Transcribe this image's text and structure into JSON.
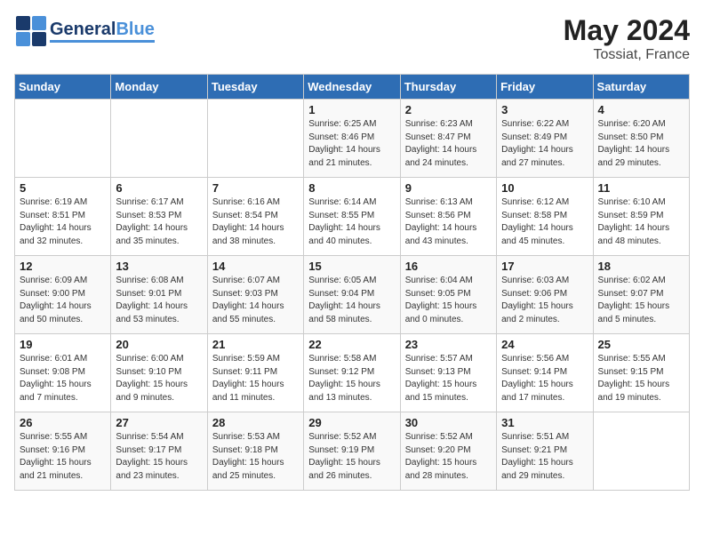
{
  "header": {
    "logo_general": "General",
    "logo_blue": "Blue",
    "month_year": "May 2024",
    "location": "Tossiat, France"
  },
  "days_of_week": [
    "Sunday",
    "Monday",
    "Tuesday",
    "Wednesday",
    "Thursday",
    "Friday",
    "Saturday"
  ],
  "weeks": [
    [
      {
        "day": "",
        "info": ""
      },
      {
        "day": "",
        "info": ""
      },
      {
        "day": "",
        "info": ""
      },
      {
        "day": "1",
        "info": "Sunrise: 6:25 AM\nSunset: 8:46 PM\nDaylight: 14 hours\nand 21 minutes."
      },
      {
        "day": "2",
        "info": "Sunrise: 6:23 AM\nSunset: 8:47 PM\nDaylight: 14 hours\nand 24 minutes."
      },
      {
        "day": "3",
        "info": "Sunrise: 6:22 AM\nSunset: 8:49 PM\nDaylight: 14 hours\nand 27 minutes."
      },
      {
        "day": "4",
        "info": "Sunrise: 6:20 AM\nSunset: 8:50 PM\nDaylight: 14 hours\nand 29 minutes."
      }
    ],
    [
      {
        "day": "5",
        "info": "Sunrise: 6:19 AM\nSunset: 8:51 PM\nDaylight: 14 hours\nand 32 minutes."
      },
      {
        "day": "6",
        "info": "Sunrise: 6:17 AM\nSunset: 8:53 PM\nDaylight: 14 hours\nand 35 minutes."
      },
      {
        "day": "7",
        "info": "Sunrise: 6:16 AM\nSunset: 8:54 PM\nDaylight: 14 hours\nand 38 minutes."
      },
      {
        "day": "8",
        "info": "Sunrise: 6:14 AM\nSunset: 8:55 PM\nDaylight: 14 hours\nand 40 minutes."
      },
      {
        "day": "9",
        "info": "Sunrise: 6:13 AM\nSunset: 8:56 PM\nDaylight: 14 hours\nand 43 minutes."
      },
      {
        "day": "10",
        "info": "Sunrise: 6:12 AM\nSunset: 8:58 PM\nDaylight: 14 hours\nand 45 minutes."
      },
      {
        "day": "11",
        "info": "Sunrise: 6:10 AM\nSunset: 8:59 PM\nDaylight: 14 hours\nand 48 minutes."
      }
    ],
    [
      {
        "day": "12",
        "info": "Sunrise: 6:09 AM\nSunset: 9:00 PM\nDaylight: 14 hours\nand 50 minutes."
      },
      {
        "day": "13",
        "info": "Sunrise: 6:08 AM\nSunset: 9:01 PM\nDaylight: 14 hours\nand 53 minutes."
      },
      {
        "day": "14",
        "info": "Sunrise: 6:07 AM\nSunset: 9:03 PM\nDaylight: 14 hours\nand 55 minutes."
      },
      {
        "day": "15",
        "info": "Sunrise: 6:05 AM\nSunset: 9:04 PM\nDaylight: 14 hours\nand 58 minutes."
      },
      {
        "day": "16",
        "info": "Sunrise: 6:04 AM\nSunset: 9:05 PM\nDaylight: 15 hours\nand 0 minutes."
      },
      {
        "day": "17",
        "info": "Sunrise: 6:03 AM\nSunset: 9:06 PM\nDaylight: 15 hours\nand 2 minutes."
      },
      {
        "day": "18",
        "info": "Sunrise: 6:02 AM\nSunset: 9:07 PM\nDaylight: 15 hours\nand 5 minutes."
      }
    ],
    [
      {
        "day": "19",
        "info": "Sunrise: 6:01 AM\nSunset: 9:08 PM\nDaylight: 15 hours\nand 7 minutes."
      },
      {
        "day": "20",
        "info": "Sunrise: 6:00 AM\nSunset: 9:10 PM\nDaylight: 15 hours\nand 9 minutes."
      },
      {
        "day": "21",
        "info": "Sunrise: 5:59 AM\nSunset: 9:11 PM\nDaylight: 15 hours\nand 11 minutes."
      },
      {
        "day": "22",
        "info": "Sunrise: 5:58 AM\nSunset: 9:12 PM\nDaylight: 15 hours\nand 13 minutes."
      },
      {
        "day": "23",
        "info": "Sunrise: 5:57 AM\nSunset: 9:13 PM\nDaylight: 15 hours\nand 15 minutes."
      },
      {
        "day": "24",
        "info": "Sunrise: 5:56 AM\nSunset: 9:14 PM\nDaylight: 15 hours\nand 17 minutes."
      },
      {
        "day": "25",
        "info": "Sunrise: 5:55 AM\nSunset: 9:15 PM\nDaylight: 15 hours\nand 19 minutes."
      }
    ],
    [
      {
        "day": "26",
        "info": "Sunrise: 5:55 AM\nSunset: 9:16 PM\nDaylight: 15 hours\nand 21 minutes."
      },
      {
        "day": "27",
        "info": "Sunrise: 5:54 AM\nSunset: 9:17 PM\nDaylight: 15 hours\nand 23 minutes."
      },
      {
        "day": "28",
        "info": "Sunrise: 5:53 AM\nSunset: 9:18 PM\nDaylight: 15 hours\nand 25 minutes."
      },
      {
        "day": "29",
        "info": "Sunrise: 5:52 AM\nSunset: 9:19 PM\nDaylight: 15 hours\nand 26 minutes."
      },
      {
        "day": "30",
        "info": "Sunrise: 5:52 AM\nSunset: 9:20 PM\nDaylight: 15 hours\nand 28 minutes."
      },
      {
        "day": "31",
        "info": "Sunrise: 5:51 AM\nSunset: 9:21 PM\nDaylight: 15 hours\nand 29 minutes."
      },
      {
        "day": "",
        "info": ""
      }
    ]
  ]
}
